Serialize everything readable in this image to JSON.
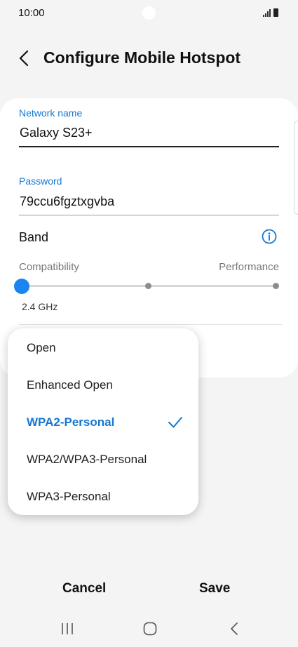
{
  "status_bar": {
    "time": "10:00"
  },
  "header": {
    "title": "Configure Mobile Hotspot"
  },
  "network_name": {
    "label": "Network name",
    "value": "Galaxy S23+"
  },
  "password": {
    "label": "Password",
    "value": "79ccu6fgztxgvba"
  },
  "band": {
    "title": "Band",
    "left_label": "Compatibility",
    "right_label": "Performance",
    "value": "2.4 GHz",
    "slider_positions": 3,
    "slider_selected_index": 0
  },
  "security_menu": {
    "options": [
      "Open",
      "Enhanced Open",
      "WPA2-Personal",
      "WPA2/WPA3-Personal",
      "WPA3-Personal"
    ],
    "selected": "WPA2-Personal"
  },
  "actions": {
    "cancel": "Cancel",
    "save": "Save"
  },
  "navigation": {
    "icons": [
      "recent-apps-icon",
      "home-icon",
      "back-icon"
    ]
  },
  "colors": {
    "accent": "#1577d1",
    "slider_thumb": "#1a84f0",
    "background": "#f4f4f4"
  }
}
